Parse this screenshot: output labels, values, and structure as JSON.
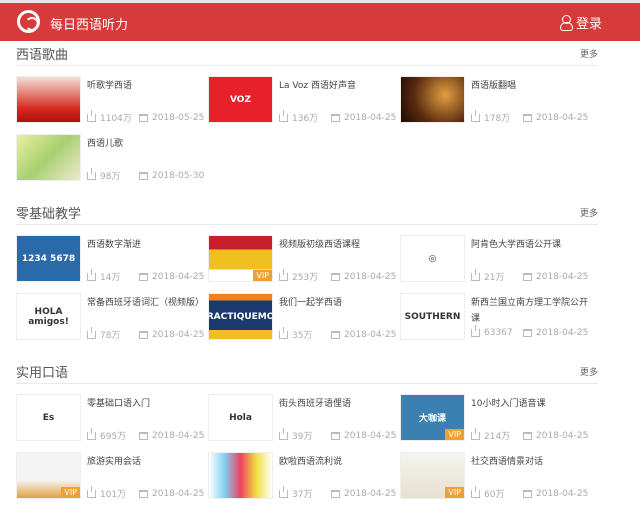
{
  "header": {
    "title": "每日西语听力",
    "login": "登录"
  },
  "sections": [
    {
      "title": "西语歌曲",
      "more": "更多",
      "items": [
        {
          "name": "听歌学西语",
          "downloads": "1104万",
          "date": "2018-05-25",
          "vip": false,
          "thumb": "linear-gradient(#f4e0d8,#d42a20 70%,#b01010)",
          "label": ""
        },
        {
          "name": "La Voz 西语好声音",
          "downloads": "136万",
          "date": "2018-04-25",
          "vip": false,
          "thumb": "#e8202a",
          "label": "VOZ"
        },
        {
          "name": "西语版翻唱",
          "downloads": "178万",
          "date": "2018-04-25",
          "vip": false,
          "thumb": "radial-gradient(circle at 70% 40%,#e0a040,#5a2a10 60%,#1a0a05)",
          "label": ""
        },
        {
          "name": "西语儿歌",
          "downloads": "98万",
          "date": "2018-05-30",
          "vip": false,
          "thumb": "linear-gradient(135deg,#e8f0a0,#a8d070,#f0e8d0)",
          "label": ""
        }
      ]
    },
    {
      "title": "零基础教学",
      "more": "更多",
      "items": [
        {
          "name": "西语数字渐进",
          "downloads": "14万",
          "date": "2018-04-25",
          "vip": false,
          "thumb": "#2a6aa8",
          "label": "1234 5678"
        },
        {
          "name": "视频版初级西语课程",
          "downloads": "253万",
          "date": "2018-04-25",
          "vip": true,
          "vip_label": "VIP",
          "thumb": "linear-gradient(#c8202a 30%,#f0c020 30%,#f0c020 75%,#fff 75%)",
          "label": ""
        },
        {
          "name": "阿肯色大学西语公开课",
          "downloads": "21万",
          "date": "2018-04-25",
          "vip": false,
          "thumb": "#fff",
          "label": "◎"
        },
        {
          "name": "常备西班牙语词汇（视频版）",
          "downloads": "78万",
          "date": "2018-04-25",
          "vip": false,
          "thumb": "#fff",
          "label": "HOLA amigos!"
        },
        {
          "name": "我们一起学西语",
          "downloads": "35万",
          "date": "2018-04-25",
          "vip": false,
          "thumb": "linear-gradient(#f08020 15%,#1a3a70 15%,#1a3a70 80%,#f0c020 80%)",
          "label": "PRACTIQUEMOS"
        },
        {
          "name": "新西兰国立南方理工学院公开课",
          "downloads": "63367",
          "date": "2018-04-25",
          "vip": false,
          "thumb": "#fff",
          "label": "SOUTHERN"
        }
      ]
    },
    {
      "title": "实用口语",
      "more": "更多",
      "items": [
        {
          "name": "零基础口语入门",
          "downloads": "695万",
          "date": "2018-04-25",
          "vip": false,
          "thumb": "#fff",
          "label": "Es"
        },
        {
          "name": "街头西班牙语俚语",
          "downloads": "39万",
          "date": "2018-04-25",
          "vip": false,
          "thumb": "#fff",
          "label": "Hola"
        },
        {
          "name": "10小时入门语音课",
          "downloads": "214万",
          "date": "2018-04-25",
          "vip": true,
          "vip_label": "VIP",
          "thumb": "#3a80b0",
          "label": "大咖课"
        },
        {
          "name": "旅游实用会话",
          "downloads": "101万",
          "date": "2018-04-25",
          "vip": true,
          "vip_label": "VIP",
          "thumb": "linear-gradient(#f4f4f4 60%,#e0a040)",
          "label": ""
        },
        {
          "name": "欧啦西语流利说",
          "downloads": "37万",
          "date": "2018-04-25",
          "vip": false,
          "thumb": "linear-gradient(90deg,#fff,#80d0f0,#f04060,#f0e040,#fff)",
          "label": ""
        },
        {
          "name": "社交西语情景对话",
          "downloads": "60万",
          "date": "2018-04-25",
          "vip": true,
          "vip_label": "VIP",
          "thumb": "linear-gradient(#f4f4f0,#e8e0d0)",
          "label": ""
        }
      ]
    }
  ]
}
